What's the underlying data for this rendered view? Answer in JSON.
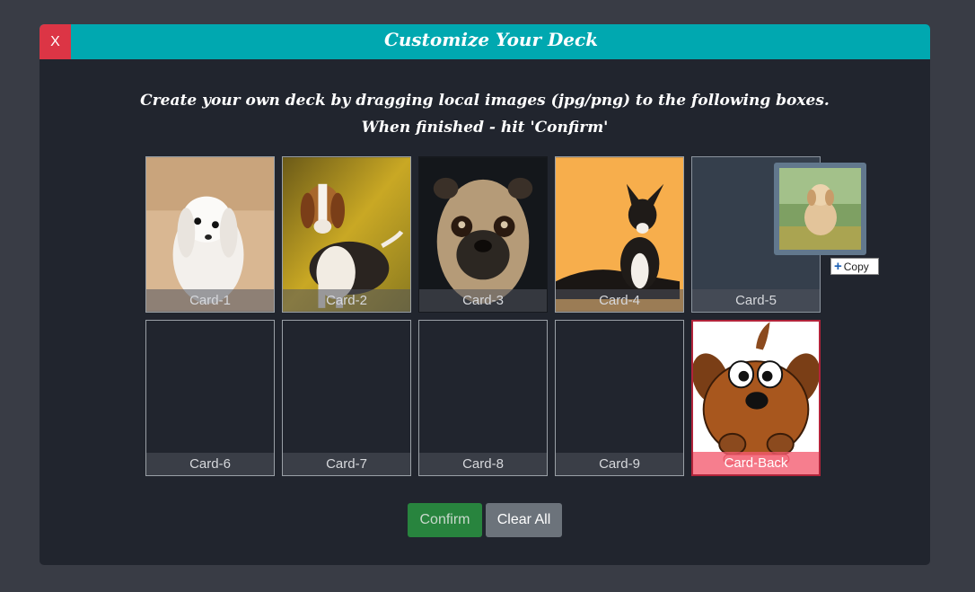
{
  "modal": {
    "title": "Customize Your Deck",
    "close_label": "X",
    "instructions_line1": "Create your own deck by dragging local images (jpg/png) to the following boxes.",
    "instructions_line2": "When finished - hit 'Confirm'"
  },
  "cards": [
    {
      "label": "Card-1",
      "image": "white-maltese-dog"
    },
    {
      "label": "Card-2",
      "image": "beagle-dog"
    },
    {
      "label": "Card-3",
      "image": "pug-dog"
    },
    {
      "label": "Card-4",
      "image": "black-white-dog-lying"
    },
    {
      "label": "Card-5",
      "image": ""
    },
    {
      "label": "Card-6",
      "image": ""
    },
    {
      "label": "Card-7",
      "image": ""
    },
    {
      "label": "Card-8",
      "image": ""
    },
    {
      "label": "Card-9",
      "image": ""
    },
    {
      "label": "Card-Back",
      "image": "cartoon-brown-dog-with-bone"
    }
  ],
  "drag": {
    "image": "golden-puppy-on-grass",
    "tooltip": "Copy"
  },
  "buttons": {
    "confirm": "Confirm",
    "clear_all": "Clear All"
  },
  "colors": {
    "header": "#00a8b0",
    "close": "#dc3545",
    "confirm": "#28843e",
    "clear": "#6c737b",
    "card_back_border": "#b2243a"
  }
}
